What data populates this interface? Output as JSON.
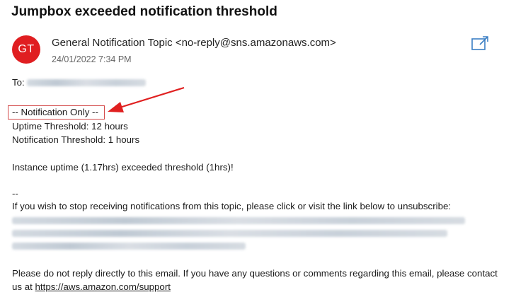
{
  "email": {
    "subject": "Jumpbox exceeded notification threshold",
    "avatar_initials": "GT",
    "avatar_color": "#e01e21",
    "sender": "General Notification Topic <no-reply@sns.amazonaws.com>",
    "date": "24/01/2022 7:34 PM",
    "to_label": "To:",
    "body": {
      "notification_only": "-- Notification Only --",
      "uptime_threshold": "Uptime Threshold: 12 hours",
      "notification_threshold": "Notification Threshold: 1 hours",
      "instance_uptime": "Instance uptime (1.17hrs) exceeded threshold (1hrs)!",
      "separator": "--",
      "unsubscribe_text": "If you wish to stop receiving notifications from this topic, please click or visit the link below to unsubscribe:",
      "footer_line1": "Please do not reply directly to this email. If you have any questions or comments regarding this email, please contact",
      "footer_prefix": "us at ",
      "support_link": "https://aws.amazon.com/support"
    }
  },
  "annotation": {
    "highlight_color": "#d44b4b",
    "arrow_color": "#e02020"
  },
  "icons": {
    "popout": "open-in-new-window-icon"
  }
}
